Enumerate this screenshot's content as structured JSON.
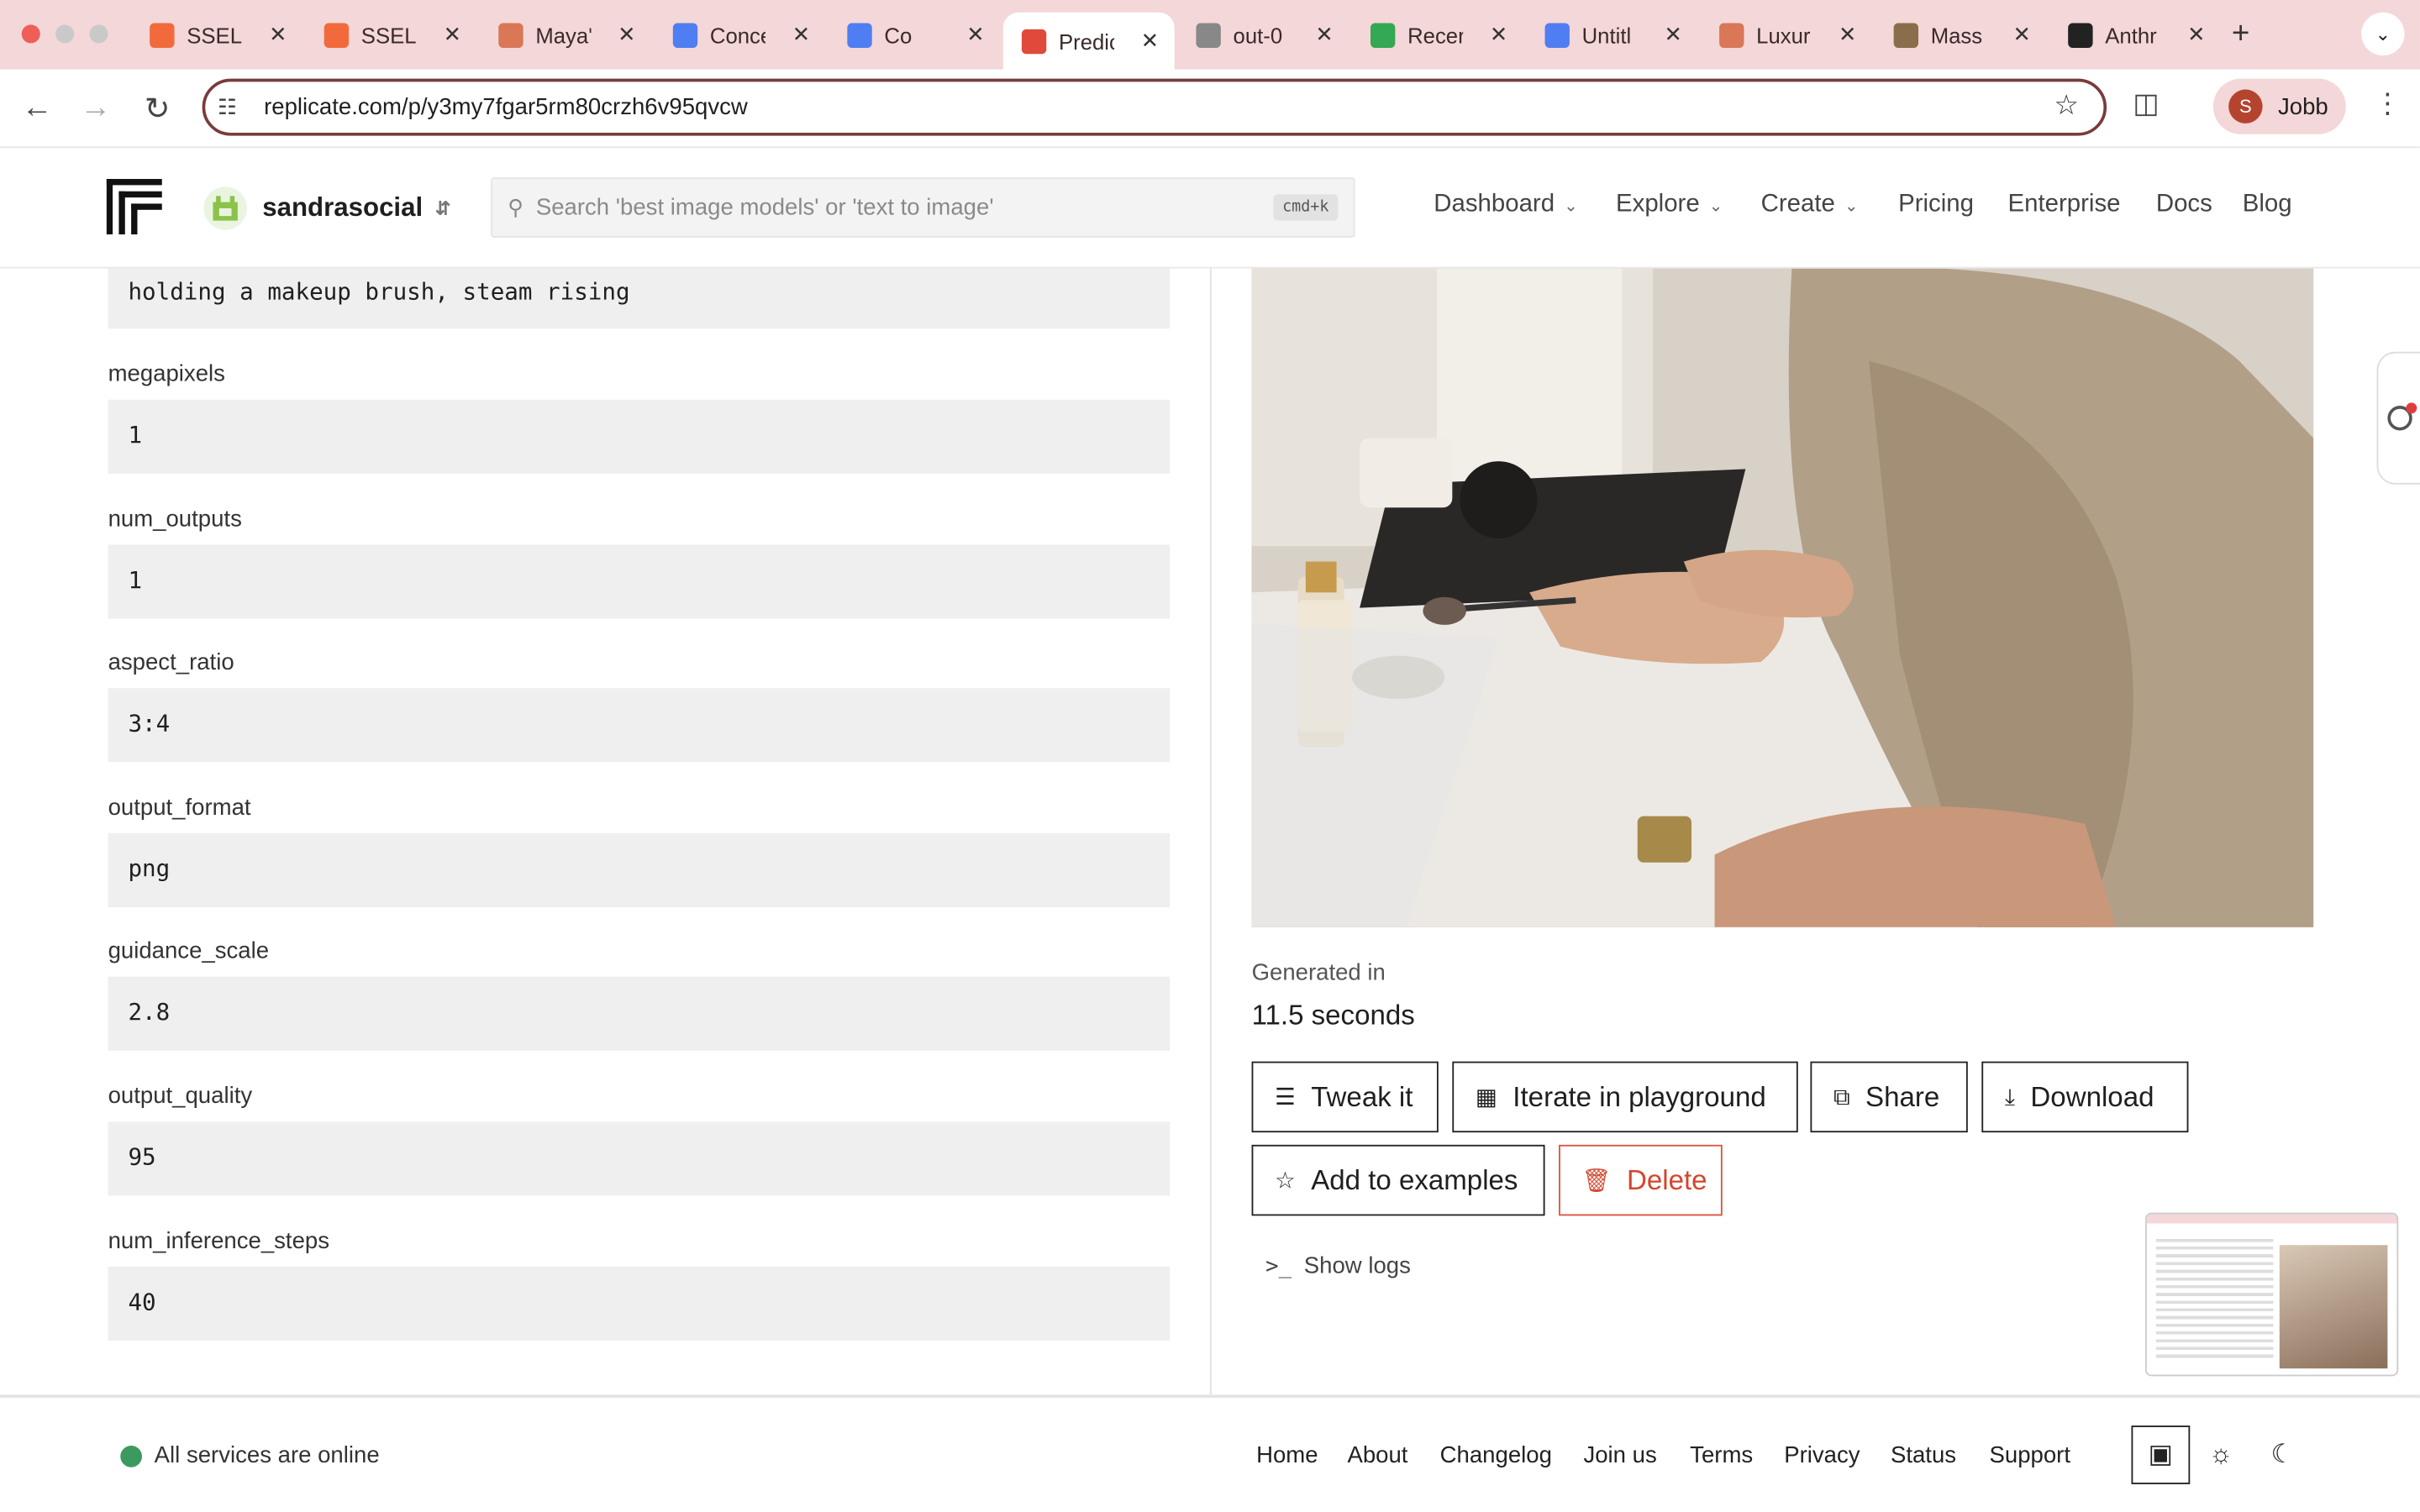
{
  "browser": {
    "tabs": [
      {
        "title": "SSELF",
        "favicon": "#f26a3c"
      },
      {
        "title": "SSELF",
        "favicon": "#f26a3c"
      },
      {
        "title": "Maya'",
        "favicon": "#d97757"
      },
      {
        "title": "Conce",
        "favicon": "#4f7ef3"
      },
      {
        "title": "Co",
        "favicon": "#4f7ef3"
      },
      {
        "title": "Predic",
        "favicon": "#e04a3a"
      },
      {
        "title": "out-0",
        "favicon": "#888888"
      },
      {
        "title": "Recer",
        "favicon": "#34a853"
      },
      {
        "title": "Untitl",
        "favicon": "#4f7ef3"
      },
      {
        "title": "Luxur",
        "favicon": "#d97757"
      },
      {
        "title": "Mass",
        "favicon": "#8a6d4a"
      },
      {
        "title": "Anthr",
        "favicon": "#222222"
      }
    ],
    "url": "replicate.com/p/y3my7fgar5rm80crzh6v95qvcw",
    "profile_initial": "S",
    "profile_name": "Jobb"
  },
  "header": {
    "org": "sandrasocial",
    "search_placeholder": "Search 'best image models' or 'text to image'",
    "search_kbd": "cmd+k",
    "nav": [
      "Dashboard",
      "Explore",
      "Create",
      "Pricing",
      "Enterprise",
      "Docs",
      "Blog"
    ]
  },
  "inputs": {
    "prompt_tail": "holding a makeup brush, steam rising",
    "fields": [
      {
        "label": "megapixels",
        "value": "1"
      },
      {
        "label": "num_outputs",
        "value": "1"
      },
      {
        "label": "aspect_ratio",
        "value": "3:4"
      },
      {
        "label": "output_format",
        "value": "png"
      },
      {
        "label": "guidance_scale",
        "value": "2.8"
      },
      {
        "label": "output_quality",
        "value": "95"
      },
      {
        "label": "num_inference_steps",
        "value": "40"
      }
    ]
  },
  "output": {
    "generated_label": "Generated in",
    "generated_value": "11.5 seconds",
    "buttons": {
      "tweak": "Tweak it",
      "iterate": "Iterate in playground",
      "share": "Share",
      "download": "Download",
      "add_examples": "Add to examples",
      "delete": "Delete"
    },
    "show_logs": "Show logs"
  },
  "footer": {
    "status": "All services are online",
    "links": [
      "Home",
      "About",
      "Changelog",
      "Join us",
      "Terms",
      "Privacy",
      "Status",
      "Support"
    ]
  }
}
